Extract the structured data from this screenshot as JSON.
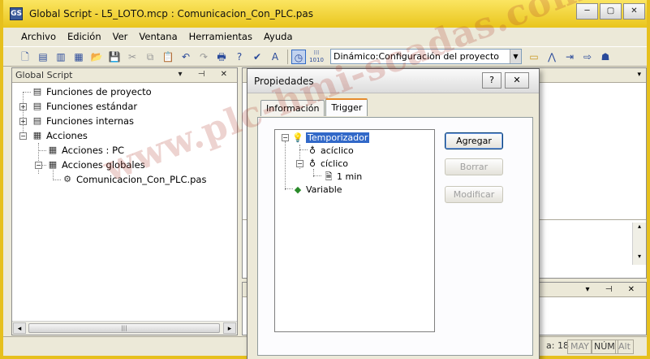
{
  "window": {
    "title": "Global Script - L5_LOTO.mcp : Comunicacion_Con_PLC.pas",
    "controls": {
      "minimize": "─",
      "restore": "▢",
      "close": "✕"
    }
  },
  "menu": [
    "Archivo",
    "Edición",
    "Ver",
    "Ventana",
    "Herramientas",
    "Ayuda"
  ],
  "toolbar": {
    "buttons": [
      {
        "name": "new-file-icon",
        "glyph": "🗋"
      },
      {
        "name": "new-project-function-icon",
        "glyph": "▤"
      },
      {
        "name": "new-standard-function-icon",
        "glyph": "▥"
      },
      {
        "name": "new-action-icon",
        "glyph": "▦"
      },
      {
        "name": "open-folder-icon",
        "glyph": "📂"
      },
      {
        "name": "save-icon",
        "glyph": "💾"
      },
      {
        "name": "cut-icon",
        "glyph": "✂"
      },
      {
        "name": "copy-icon",
        "glyph": "⧉"
      },
      {
        "name": "paste-icon",
        "glyph": "📋"
      },
      {
        "name": "undo-icon",
        "glyph": "↶"
      },
      {
        "name": "redo-icon",
        "glyph": "↷"
      },
      {
        "name": "print-icon",
        "glyph": "🖶"
      },
      {
        "name": "context-help-icon",
        "glyph": "?"
      },
      {
        "name": "compile-icon",
        "glyph": "✔"
      },
      {
        "name": "font-color-icon",
        "glyph": "A"
      }
    ],
    "trigger_clock_icon": "clock-icon",
    "trigger_grid_icon": "grid-icon",
    "trigger_grid_label": "1010",
    "dynamic_select": "Dinámico:Configuración del proyecto",
    "right_buttons": [
      {
        "name": "folder-icon",
        "glyph": "▭"
      },
      {
        "name": "compass-icon",
        "glyph": "⋀"
      },
      {
        "name": "import-icon",
        "glyph": "⇥"
      },
      {
        "name": "export-icon",
        "glyph": "⇨"
      },
      {
        "name": "people-icon",
        "glyph": "☗"
      }
    ]
  },
  "left_panel": {
    "title": "Global Script",
    "header_buttons": "▾ ⊣ ✕",
    "tree": [
      {
        "label": "Funciones de proyecto",
        "level": 0,
        "expander": ""
      },
      {
        "label": "Funciones estándar",
        "level": 0,
        "expander": "+"
      },
      {
        "label": "Funciones internas",
        "level": 0,
        "expander": "+"
      },
      {
        "label": "Acciones",
        "level": 0,
        "expander": "−"
      },
      {
        "label": "Acciones : PC",
        "level": 1,
        "expander": ""
      },
      {
        "label": "Acciones globales",
        "level": 1,
        "expander": "−"
      },
      {
        "label": "Comunicacion_Con_PLC.pas",
        "level": 2,
        "expander": ""
      }
    ],
    "scroll": {
      "left": "◂",
      "right": "▸",
      "thumb": "|||"
    }
  },
  "editor": {
    "down_arrow": "▾",
    "scroll_up": "▴",
    "scroll_down": "▾"
  },
  "bottom_panel": {
    "header_buttons": "▾ ⊣ ✕"
  },
  "statusbar": {
    "line_label": "a: 18",
    "may": "MAY",
    "num": "NÚM",
    "alt": "Alt"
  },
  "dialog": {
    "title": "Propiedades",
    "help_button": "?",
    "close_button": "✕",
    "tabs": [
      {
        "label": "Información",
        "active": false
      },
      {
        "label": "Trigger",
        "active": true
      }
    ],
    "trigger_tree": [
      {
        "label": "Temporizador",
        "level": 0,
        "expander": "−",
        "icon": "bulb",
        "selected": true
      },
      {
        "label": "acíclico",
        "level": 1,
        "expander": "",
        "icon": "bulb",
        "selected": false
      },
      {
        "label": "cíclico",
        "level": 1,
        "expander": "−",
        "icon": "bulb",
        "selected": false
      },
      {
        "label": "1 min",
        "level": 2,
        "expander": "",
        "icon": "doc",
        "selected": false
      },
      {
        "label": "Variable",
        "level": 0,
        "expander": "",
        "icon": "variable",
        "selected": false
      }
    ],
    "buttons": {
      "agregar": "Agregar",
      "borrar": "Borrar",
      "modificar": "Modificar"
    }
  },
  "watermark": "www.plc-hmi-scadas.com",
  "colors": {
    "title_bar": "#e9c51c",
    "selection": "#3168c8",
    "watermark": "#af3728"
  }
}
